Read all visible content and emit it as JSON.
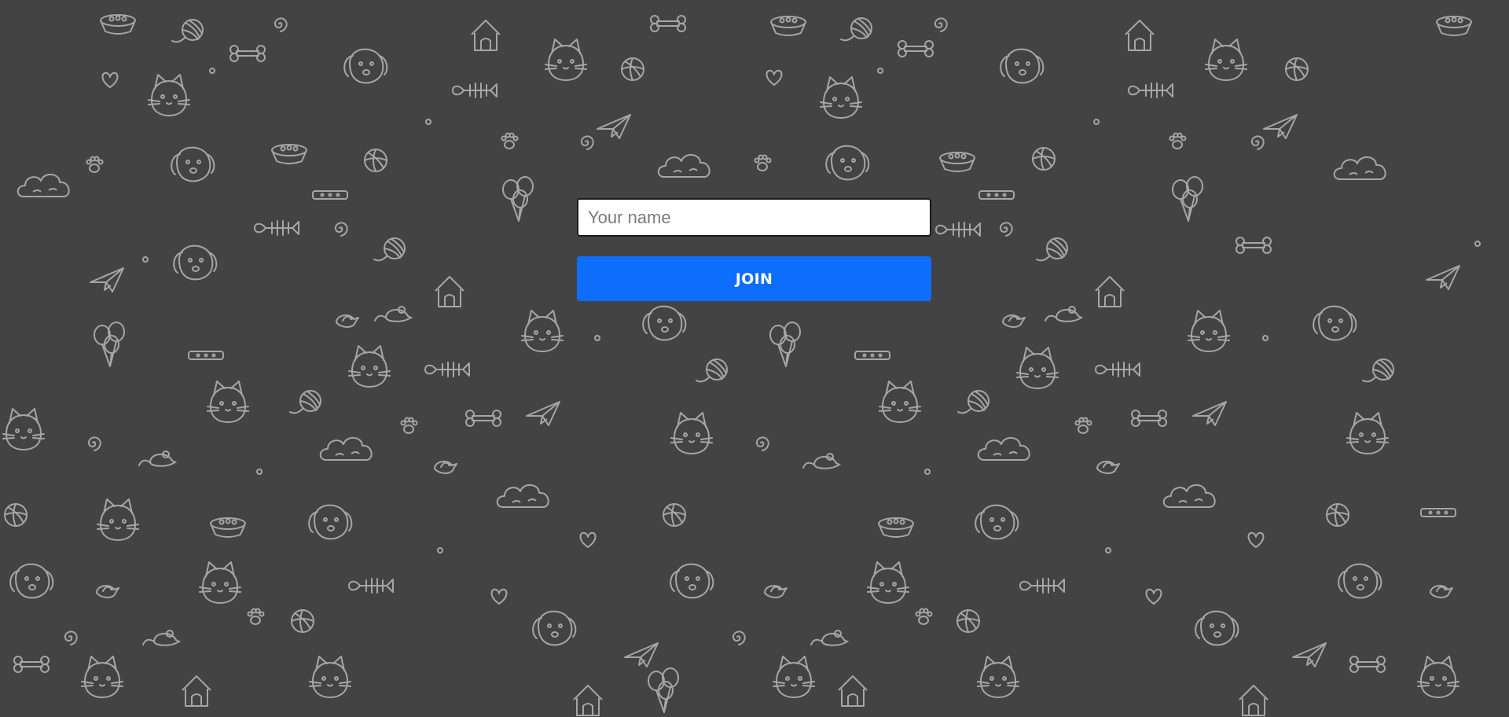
{
  "theme": {
    "background": "#434343",
    "doodle_stroke": "#a6a6a6",
    "button_color": "#0d6efd",
    "button_text_color": "#ffffff"
  },
  "background": {
    "pattern": "pet-doodles-icon",
    "motifs": [
      "cat",
      "dog",
      "bone",
      "yarn-ball",
      "fish-skeleton",
      "paper-plane",
      "balloons",
      "dog-house",
      "ball",
      "heart",
      "paw-print",
      "cloud",
      "bird",
      "mouse",
      "pet-bowl",
      "collar",
      "spiral"
    ]
  },
  "join_form": {
    "name_input": {
      "value": "",
      "placeholder": "Your name"
    },
    "join_button": {
      "label": "JOIN"
    }
  }
}
